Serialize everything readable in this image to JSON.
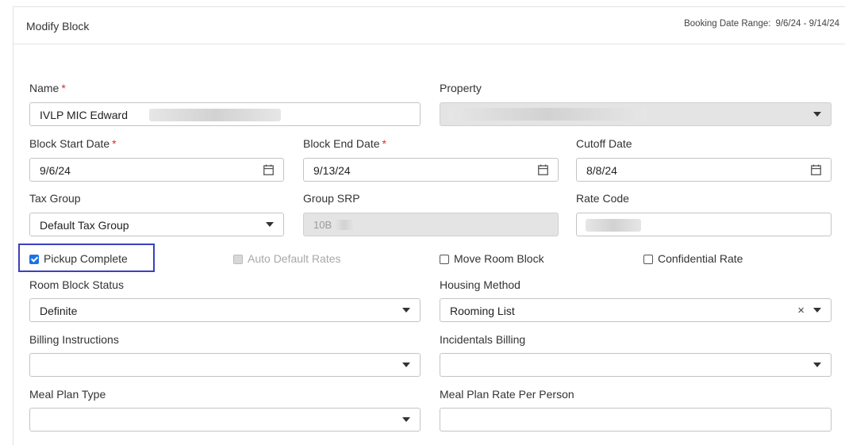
{
  "header": {
    "title": "Modify Block",
    "range_label": "Booking Date Range:",
    "range_value": "9/6/24 - 9/14/24"
  },
  "fields": {
    "name": {
      "label": "Name",
      "value": "IVLP MIC Edward"
    },
    "property": {
      "label": "Property"
    },
    "block_start": {
      "label": "Block Start Date",
      "value": "9/6/24"
    },
    "block_end": {
      "label": "Block End Date",
      "value": "9/13/24"
    },
    "cutoff": {
      "label": "Cutoff Date",
      "value": "8/8/24"
    },
    "tax_group": {
      "label": "Tax Group",
      "value": "Default Tax Group"
    },
    "group_srp": {
      "label": "Group SRP",
      "value": "10B"
    },
    "rate_code": {
      "label": "Rate Code"
    },
    "room_block_status": {
      "label": "Room Block Status",
      "value": "Definite"
    },
    "housing_method": {
      "label": "Housing Method",
      "value": "Rooming List"
    },
    "billing_instructions": {
      "label": "Billing Instructions",
      "value": ""
    },
    "incidentals_billing": {
      "label": "Incidentals Billing",
      "value": ""
    },
    "meal_plan_type": {
      "label": "Meal Plan Type",
      "value": ""
    },
    "meal_plan_rate": {
      "label": "Meal Plan Rate Per Person",
      "value": ""
    }
  },
  "checkboxes": {
    "pickup_complete": {
      "label": "Pickup Complete",
      "checked": true
    },
    "auto_default_rates": {
      "label": "Auto Default Rates",
      "checked": false,
      "disabled": true
    },
    "move_room_block": {
      "label": "Move Room Block",
      "checked": false
    },
    "confidential_rate": {
      "label": "Confidential Rate",
      "checked": false
    }
  },
  "required_marker": "*",
  "clear_glyph": "×",
  "colors": {
    "accent": "#1a73e8",
    "required": "#d32f2f",
    "highlight": "#3b3fc1"
  }
}
